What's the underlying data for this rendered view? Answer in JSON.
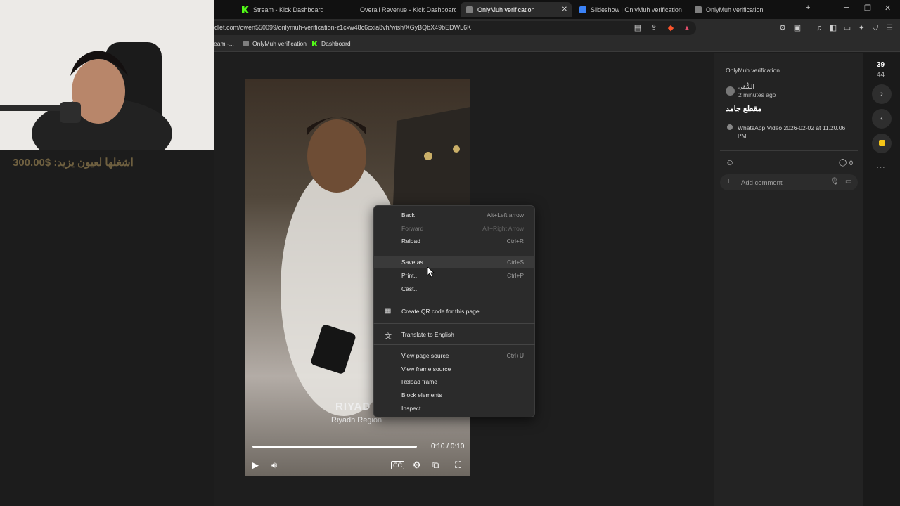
{
  "tabs": [
    {
      "label": "Stream - Kick Dashboard",
      "icon": "kick-icon"
    },
    {
      "label": "Overall Revenue - Kick Dashboard",
      "icon": "kick-icon"
    },
    {
      "label": "OnlyMuh verification",
      "icon": "padlet-icon",
      "active": true
    },
    {
      "label": "Slideshow | OnlyMuh verification",
      "icon": "slideshow-icon"
    },
    {
      "label": "OnlyMuh verification",
      "icon": "padlet-icon"
    }
  ],
  "address": {
    "url": "adlet.com/owen550099/onlymuh-verification-z1cxw48c6cxia8vh/wish/XGyBQbX49bEDWL6K"
  },
  "bookmarks": [
    {
      "label": "eam -..."
    },
    {
      "label": "OnlyMuh verification"
    },
    {
      "label": "Dashboard"
    }
  ],
  "overlay": {
    "donation": "اشغلها لعيون يزيد: $300.00"
  },
  "video": {
    "location_title": "RIYAD",
    "location_sub": "Riyadh Region",
    "time": "0:10 / 0:10",
    "progress": 1.0
  },
  "post": {
    "board": "OnlyMuh verification",
    "author": "السُّقي",
    "posted": "2 minutes ago",
    "title": "مقطع جامد",
    "attachment": "WhatsApp Video 2026-02-02 at 11.20.06 PM",
    "comment_count": "0",
    "comment_placeholder": "Add comment"
  },
  "rail": {
    "counter_top": "39",
    "counter_bottom": "44"
  },
  "context_menu": {
    "items": [
      {
        "label": "Back",
        "shortcut": "Alt+Left arrow"
      },
      {
        "label": "Forward",
        "shortcut": "Alt+Right Arrow",
        "disabled": true
      },
      {
        "label": "Reload",
        "shortcut": "Ctrl+R"
      },
      {
        "label": "Save as...",
        "shortcut": "Ctrl+S"
      },
      {
        "label": "Print...",
        "shortcut": "Ctrl+P"
      },
      {
        "label": "Cast...",
        "shortcut": ""
      },
      {
        "label": "Create QR code for this page",
        "shortcut": ""
      },
      {
        "label": "Translate to English",
        "shortcut": ""
      },
      {
        "label": "View page source",
        "shortcut": "Ctrl+U"
      },
      {
        "label": "View frame source",
        "shortcut": ""
      },
      {
        "label": "Reload frame",
        "shortcut": ""
      },
      {
        "label": "Block elements",
        "shortcut": ""
      },
      {
        "label": "Inspect",
        "shortcut": ""
      }
    ]
  }
}
